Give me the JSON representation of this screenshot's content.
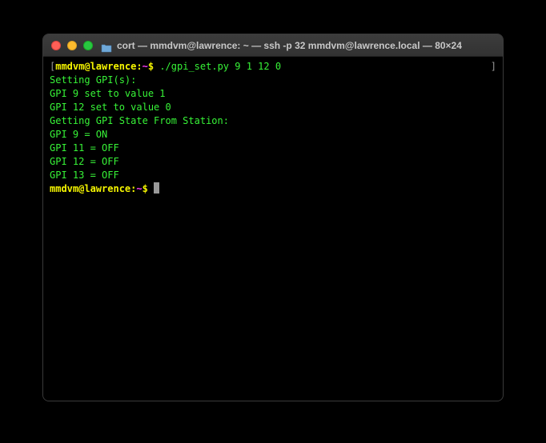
{
  "titlebar": {
    "title": "cort — mmdvm@lawrence: ~ — ssh -p 32 mmdvm@lawrence.local — 80×24"
  },
  "prompt": {
    "user_host": "mmdvm@lawrence",
    "separator": ":",
    "path": "~",
    "symbol": "$"
  },
  "command": "./gpi_set.py 9 1 12 0",
  "output": {
    "l1": "Setting GPI(s):",
    "l2": "GPI 9 set to value 1",
    "l3": "GPI 12 set to value 0",
    "l4": "",
    "l5": "Getting GPI State From Station:",
    "l6": "GPI 9 = ON",
    "l7": "GPI 11 = OFF",
    "l8": "GPI 12 = OFF",
    "l9": "GPI 13 = OFF"
  },
  "brackets": {
    "open": "[",
    "close": "]"
  }
}
